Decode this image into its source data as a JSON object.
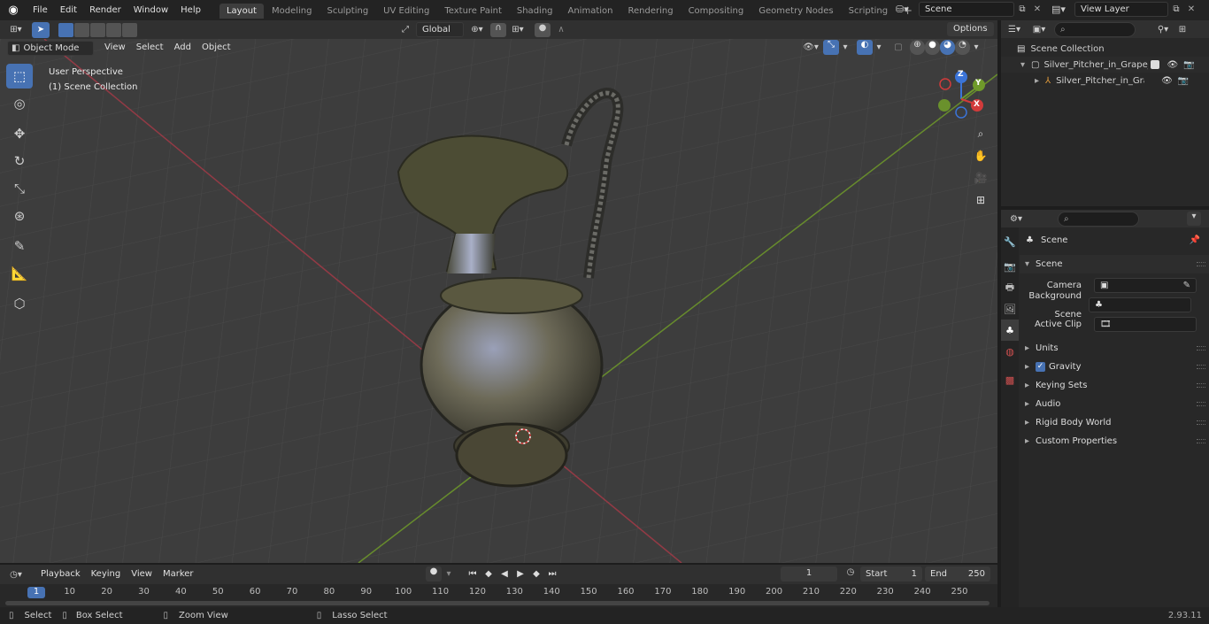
{
  "app": {
    "version": "2.93.11"
  },
  "top_menu": [
    "File",
    "Edit",
    "Render",
    "Window",
    "Help"
  ],
  "workspace_tabs": [
    {
      "label": "Layout",
      "active": true
    },
    {
      "label": "Modeling",
      "active": false
    },
    {
      "label": "Sculpting",
      "active": false
    },
    {
      "label": "UV Editing",
      "active": false
    },
    {
      "label": "Texture Paint",
      "active": false
    },
    {
      "label": "Shading",
      "active": false
    },
    {
      "label": "Animation",
      "active": false
    },
    {
      "label": "Rendering",
      "active": false
    },
    {
      "label": "Compositing",
      "active": false
    },
    {
      "label": "Geometry Nodes",
      "active": false
    },
    {
      "label": "Scripting",
      "active": false
    }
  ],
  "scene_selector": {
    "value": "Scene"
  },
  "view_layer_selector": {
    "value": "View Layer"
  },
  "viewport_header": {
    "mode": "Object Mode",
    "menus": [
      "View",
      "Select",
      "Add",
      "Object"
    ],
    "orientation": "Global",
    "options_label": "Options"
  },
  "viewport_overlay": {
    "perspective": "User Perspective",
    "collection": "(1) Scene Collection"
  },
  "gizmo_axes": {
    "z": "Z",
    "y": "Y",
    "x": "X"
  },
  "outliner": {
    "root": "Scene Collection",
    "items": [
      {
        "label": "Silver_Pitcher_in_Grape_Patte"
      },
      {
        "label": "Silver_Pitcher_in_Grape_F"
      }
    ]
  },
  "properties": {
    "context_label": "Scene",
    "section_scene": "Scene",
    "fields": [
      {
        "label": "Camera",
        "value": ""
      },
      {
        "label": "Background Scene",
        "value": ""
      },
      {
        "label": "Active Clip",
        "value": ""
      }
    ],
    "panels": [
      "Units",
      "Gravity",
      "Keying Sets",
      "Audio",
      "Rigid Body World",
      "Custom Properties"
    ],
    "gravity_checked": true
  },
  "timeline": {
    "menus": [
      "Playback",
      "Keying",
      "View",
      "Marker"
    ],
    "current_frame": "1",
    "start_label": "Start",
    "start_value": "1",
    "end_label": "End",
    "end_value": "250",
    "ruler": [
      "1",
      "10",
      "20",
      "30",
      "40",
      "50",
      "60",
      "70",
      "80",
      "90",
      "100",
      "110",
      "120",
      "130",
      "140",
      "150",
      "160",
      "170",
      "180",
      "190",
      "200",
      "210",
      "220",
      "230",
      "240",
      "250"
    ]
  },
  "statusbar": {
    "select": "Select",
    "box_select": "Box Select",
    "zoom_view": "Zoom View",
    "lasso_select": "Lasso Select"
  },
  "colors": {
    "accent": "#4772b3",
    "x_axis": "#b03a48",
    "y_axis": "#6f9a2a",
    "viewport_bg": "#3d3d3d",
    "panel_bg": "#282828"
  }
}
